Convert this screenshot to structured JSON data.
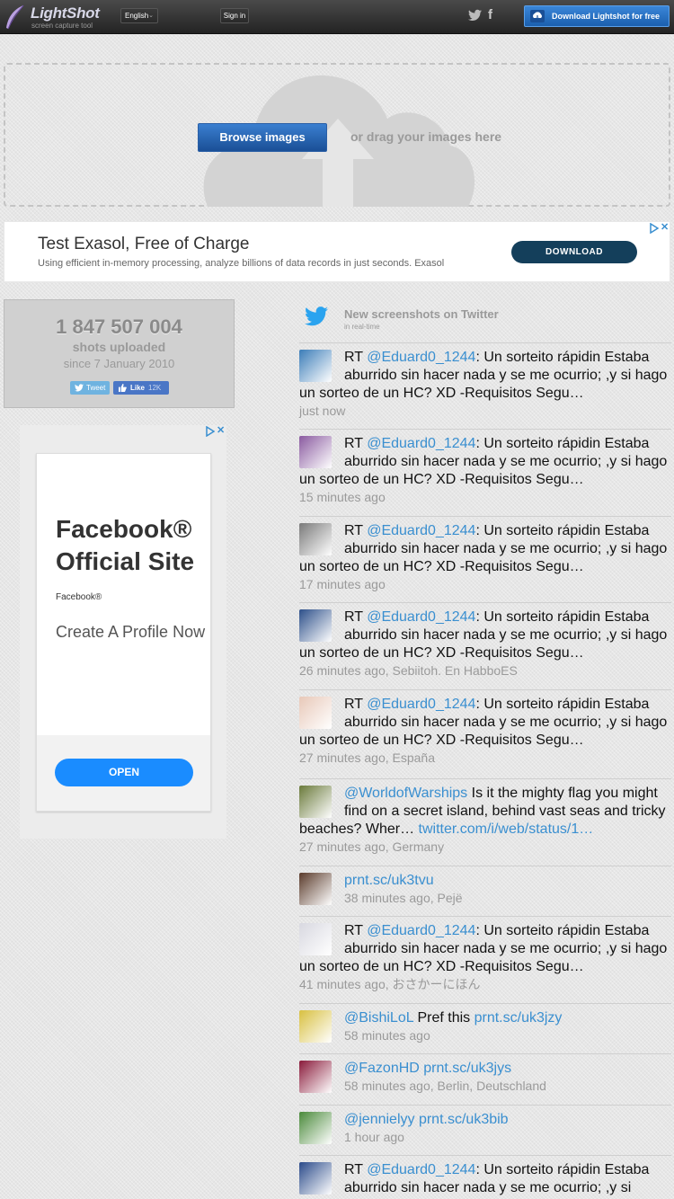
{
  "header": {
    "logo_text": "LightShot",
    "logo_tagline": "screen capture tool",
    "language": "English",
    "signin_label": "Sign in",
    "download_label": "Download Lightshot for free"
  },
  "upload": {
    "browse_label": "Browse images",
    "drag_text": "or drag your images here"
  },
  "ad_top": {
    "title": "Test Exasol, Free of Charge",
    "subtitle": "Using efficient in-memory processing, analyze billions of data records in just seconds. Exasol",
    "cta": "DOWNLOAD"
  },
  "stats": {
    "count": "1 847 507 004",
    "label": "shots uploaded",
    "since": "since 7 January 2010",
    "tweet_label": "Tweet",
    "like_label": "Like",
    "like_count": "12K"
  },
  "ad_side": {
    "title": "Facebook® Official Site",
    "brand": "Facebook®",
    "description": "Create A Profile Now",
    "cta": "OPEN"
  },
  "twitter_feed": {
    "title": "New screenshots on Twitter",
    "subtitle": "in real-time",
    "tweets": [
      {
        "prefix": "RT ",
        "handle": "@Eduard0_1244",
        "text": ": Un sorteito rápidin Estaba aburrido sin hacer nada y se me ocurrio; ,y si hago un sorteo de un HC? XD -Requisitos Segu…",
        "meta": "just now",
        "avatar_color": "#3b7db8"
      },
      {
        "prefix": "RT ",
        "handle": "@Eduard0_1244",
        "text": ": Un sorteito rápidin Estaba aburrido sin hacer nada y se me ocurrio; ,y si hago un sorteo de un HC? XD -Requisitos Segu…",
        "meta": "15 minutes ago",
        "avatar_color": "#8a5aa0"
      },
      {
        "prefix": "RT ",
        "handle": "@Eduard0_1244",
        "text": ": Un sorteito rápidin Estaba aburrido sin hacer nada y se me ocurrio; ,y si hago un sorteo de un HC? XD -Requisitos Segu…",
        "meta": "17 minutes ago",
        "avatar_color": "#7a7a7a"
      },
      {
        "prefix": "RT ",
        "handle": "@Eduard0_1244",
        "text": ": Un sorteito rápidin Estaba aburrido sin hacer nada y se me ocurrio; ,y si hago un sorteo de un HC? XD -Requisitos Segu…",
        "meta": "26 minutes ago, Sebiitoh. En HabboES",
        "avatar_color": "#2c4f8a"
      },
      {
        "prefix": "RT ",
        "handle": "@Eduard0_1244",
        "text": ": Un sorteito rápidin Estaba aburrido sin hacer nada y se me ocurrio; ,y si hago un sorteo de un HC? XD -Requisitos Segu…",
        "meta": "27 minutes ago, España",
        "avatar_color": "#e8c8b8"
      },
      {
        "prefix": "",
        "handle": "@WorldofWarships",
        "text": " Is it the mighty flag you might find on a secret island, behind vast seas and tricky beaches? Wher… ",
        "link": "twitter.com/i/web/status/1…",
        "meta": "27 minutes ago, Germany",
        "avatar_color": "#6a7a3a"
      },
      {
        "prefix": "",
        "handle": "prnt.sc/uk3tvu",
        "text": "",
        "meta": "38 minutes ago, Pejë",
        "avatar_color": "#5a3a2a"
      },
      {
        "prefix": "RT ",
        "handle": "@Eduard0_1244",
        "text": ": Un sorteito rápidin Estaba aburrido sin hacer nada y se me ocurrio; ,y si hago un sorteo de un HC? XD -Requisitos Segu…",
        "meta": "41 minutes ago, おさかーにほん",
        "avatar_color": "#d8d8e0"
      },
      {
        "prefix": "",
        "handle": "@BishiLoL",
        "text": " Pref this ",
        "link": "prnt.sc/uk3jzy",
        "meta": "58 minutes ago",
        "avatar_color": "#d8c040"
      },
      {
        "prefix": "",
        "handle": "@FazonHD",
        "text": " ",
        "link": "prnt.sc/uk3jys",
        "meta": "58 minutes ago, Berlin, Deutschland",
        "avatar_color": "#8a1a3a"
      },
      {
        "prefix": "",
        "handle": "@jennielyy",
        "text": " ",
        "link": "prnt.sc/uk3bib",
        "meta": "1 hour ago",
        "avatar_color": "#4a8a3a"
      },
      {
        "prefix": "RT ",
        "handle": "@Eduard0_1244",
        "text": ": Un sorteito rápidin Estaba aburrido sin hacer nada y se me ocurrio; ,y si",
        "meta": "",
        "avatar_color": "#2a4a8a"
      }
    ]
  }
}
